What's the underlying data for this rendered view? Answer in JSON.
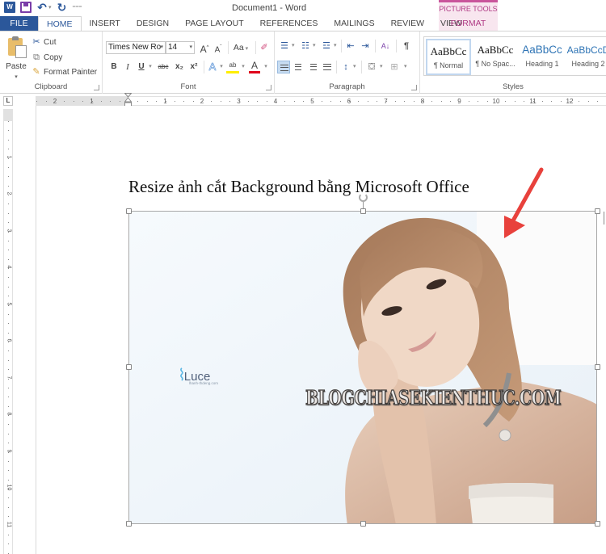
{
  "titlebar": {
    "title": "Document1 - Word",
    "app_logo": "W",
    "qat": [
      "save-icon",
      "undo-icon",
      "redo-icon",
      "customize-icon"
    ],
    "contextual_group": "PICTURE TOOLS"
  },
  "tabs": [
    {
      "label": "FILE"
    },
    {
      "label": "HOME",
      "active": true
    },
    {
      "label": "INSERT"
    },
    {
      "label": "DESIGN"
    },
    {
      "label": "PAGE LAYOUT"
    },
    {
      "label": "REFERENCES"
    },
    {
      "label": "MAILINGS"
    },
    {
      "label": "REVIEW"
    },
    {
      "label": "VIEW"
    },
    {
      "label": "FORMAT",
      "contextual": true
    }
  ],
  "ribbon": {
    "clipboard": {
      "label": "Clipboard",
      "paste": "Paste",
      "cut": "Cut",
      "copy": "Copy",
      "format_painter": "Format Painter"
    },
    "font": {
      "label": "Font",
      "font_name": "Times New Ro",
      "font_size": "14",
      "grow": "A",
      "shrink": "A",
      "change_case": "Aa",
      "bold": "B",
      "italic": "I",
      "underline": "U",
      "strikethrough": "abc",
      "subscript": "x₂",
      "superscript": "x²",
      "text_effects": "A",
      "highlight": "ab",
      "font_color": "A",
      "highlight_color": "#ffee00",
      "font_color_value": "#e0001b"
    },
    "paragraph": {
      "label": "Paragraph",
      "sort": "A↓",
      "show_marks": "¶",
      "selected_align": "align-left"
    },
    "styles": {
      "label": "Styles",
      "items": [
        {
          "preview": "AaBbCc",
          "name": "¶ Normal",
          "selected": true
        },
        {
          "preview": "AaBbCc",
          "name": "¶ No Spac..."
        },
        {
          "preview": "AaBbCc",
          "name": "Heading 1"
        },
        {
          "preview": "AaBbCcD",
          "name": "Heading 2"
        }
      ]
    }
  },
  "ruler": {
    "tab_selector": "L",
    "horizontal_ticks_left": [
      "2",
      "1"
    ],
    "horizontal_ticks_right": [
      "1",
      "2",
      "3",
      "4",
      "5",
      "6",
      "7",
      "8",
      "9",
      "10",
      "11",
      "12"
    ],
    "vertical_ticks": [
      "1",
      "2",
      "3",
      "4",
      "5",
      "6",
      "7",
      "8",
      "9",
      "10",
      "11"
    ]
  },
  "document": {
    "heading": "Resize ảnh cắt Background bằng Microsoft Office",
    "picture": {
      "logo_text": "Luce",
      "logo_sub": "lhanh-thdeng.com",
      "watermark": "BLOGCHIASEKIENTHUC.COM"
    },
    "annotation_arrow_color": "#e8413c"
  },
  "colors": {
    "file_tab": "#2b579a",
    "accent": "#2b579a",
    "picture_tools": "#b03a85"
  }
}
